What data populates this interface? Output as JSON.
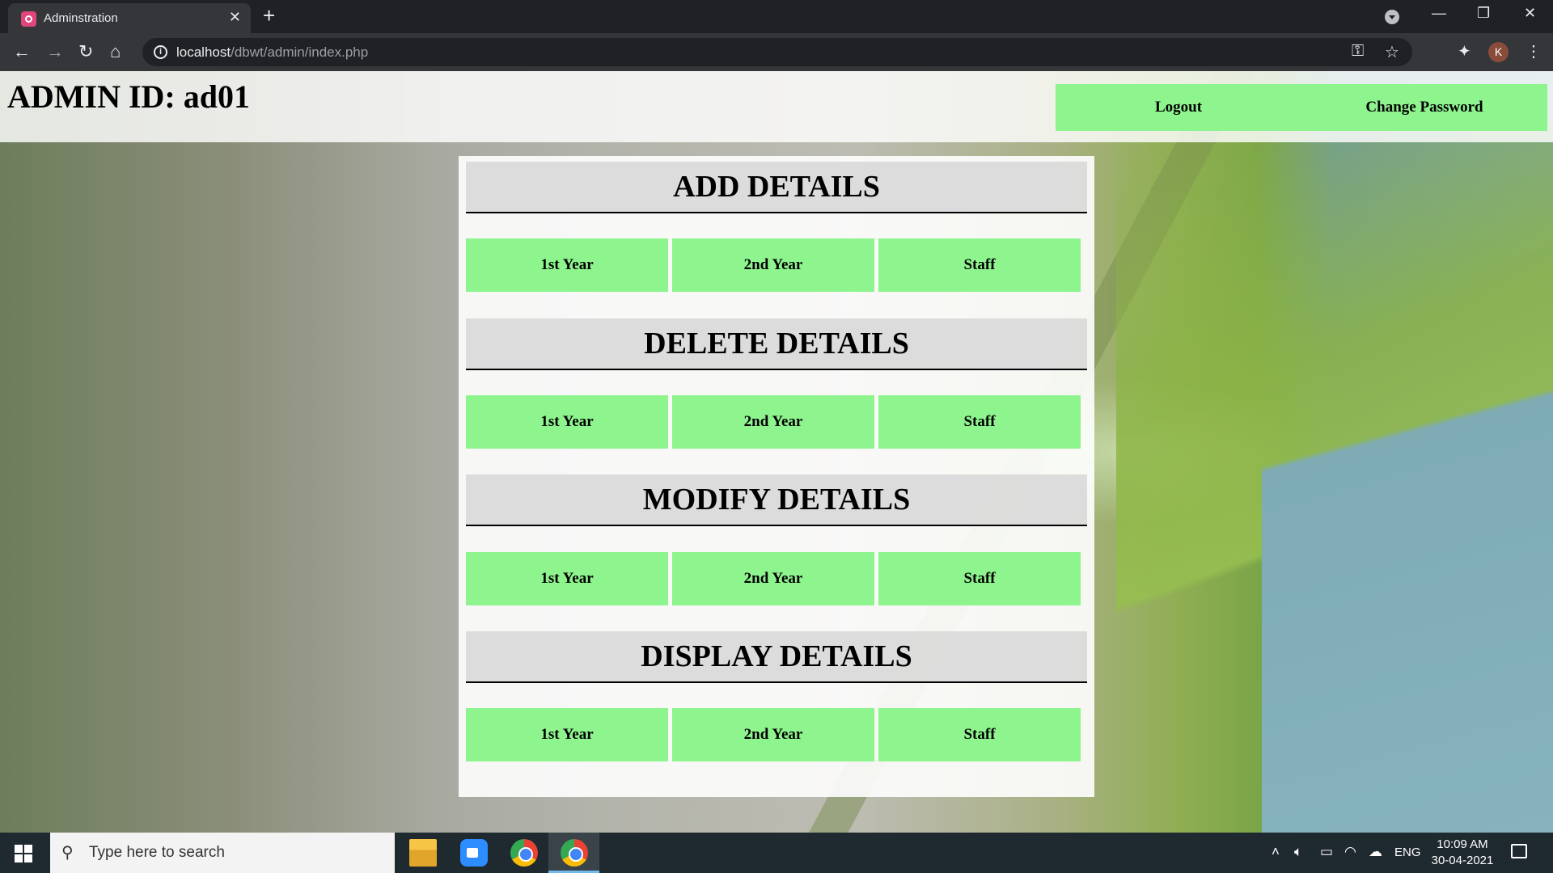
{
  "browser": {
    "tab_title": "Adminstration",
    "tab_close": "✕",
    "new_tab": "+",
    "url_host": "localhost",
    "url_path": "/dbwt/admin/index.php",
    "window_controls": {
      "minimize": "—",
      "restore": "❐",
      "close": "✕"
    },
    "nav": {
      "back": "←",
      "forward": "→",
      "reload": "↻",
      "home": "⌂"
    },
    "icons": {
      "key": "⚿",
      "star": "☆",
      "extensions": "✦",
      "menu": "⋮"
    },
    "profile_initial": "K"
  },
  "header": {
    "admin_id": "ADMIN ID: ad01",
    "logout_label": "Logout",
    "change_password_label": "Change Password"
  },
  "sections": [
    {
      "title": "ADD DETAILS",
      "buttons": [
        "1st Year",
        "2nd Year",
        "Staff"
      ]
    },
    {
      "title": "DELETE DETAILS",
      "buttons": [
        "1st Year",
        "2nd Year",
        "Staff"
      ]
    },
    {
      "title": "MODIFY DETAILS",
      "buttons": [
        "1st Year",
        "2nd Year",
        "Staff"
      ]
    },
    {
      "title": "DISPLAY DETAILS",
      "buttons": [
        "1st Year",
        "2nd Year",
        "Staff"
      ]
    }
  ],
  "taskbar": {
    "search_placeholder": "Type here to search",
    "language": "ENG",
    "time": "10:09 AM",
    "date": "30-04-2021"
  },
  "colors": {
    "button_green": "#8ef48e",
    "chrome_dark": "#202124",
    "chrome_toolbar": "#35363a"
  }
}
